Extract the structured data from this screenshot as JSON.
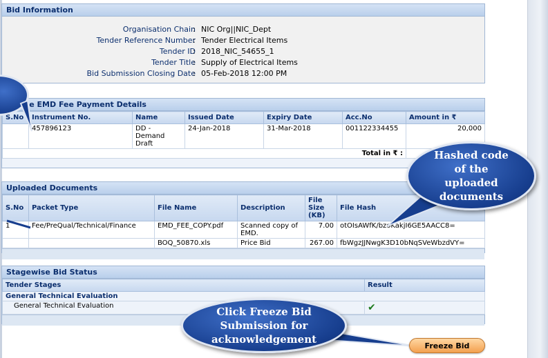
{
  "bid_info": {
    "title": "Bid Information",
    "rows": [
      {
        "label": "Organisation Chain",
        "value": "NIC Org||NIC_Dept"
      },
      {
        "label": "Tender Reference Number",
        "value": "Tender Electrical Items"
      },
      {
        "label": "Tender ID",
        "value": "2018_NIC_54655_1"
      },
      {
        "label": "Tender Title",
        "value": "Supply of Electrical Items"
      },
      {
        "label": "Bid Submission Closing Date",
        "value": "05-Feb-2018 12:00 PM"
      }
    ]
  },
  "emd": {
    "title": "Offline EMD Fee Payment Details",
    "columns": [
      "S.No",
      "Instrument No.",
      "Name",
      "Issued Date",
      "Expiry Date",
      "Acc.No",
      "Amount in ₹"
    ],
    "rows": [
      {
        "sno": "",
        "instrument": "457896123",
        "name": "DD - Demand Draft",
        "issued": "24-Jan-2018",
        "expiry": "31-Mar-2018",
        "acc": "001122334455",
        "amount": "20,000"
      }
    ],
    "total_label": "Total in ₹ :"
  },
  "uploads": {
    "title": "Uploaded Documents",
    "columns": [
      "S.No",
      "Packet Type",
      "File Name",
      "Description",
      "File Size (KB)",
      "File Hash"
    ],
    "rows": [
      {
        "sno": "1",
        "packet": "Fee/PreQual/Technical/Finance",
        "file": "EMD_FEE_COPY.pdf",
        "desc": "Scanned copy of EMD.",
        "size": "7.00",
        "hash": "otOIsAWfK/bzoKakjI6GE5AACC8="
      },
      {
        "sno": "",
        "packet": "",
        "file": "BOQ_50870.xls",
        "desc": "Price Bid",
        "size": "267.00",
        "hash": "fbWgzJJNwgK3D10bNqSVeWbzdVY="
      }
    ]
  },
  "stages": {
    "title": "Stagewise Bid Status",
    "columns": [
      "Tender Stages",
      "Result"
    ],
    "group": "General Technical Evaluation",
    "items": [
      {
        "stage": "General Technical Evaluation",
        "result": "✔"
      }
    ]
  },
  "callouts": {
    "hash": [
      "Hashed code",
      "of the",
      "uploaded",
      "documents"
    ],
    "freeze": [
      "Click Freeze Bid",
      "Submission for",
      "acknowledgement"
    ]
  },
  "freeze_button": "Freeze Bid",
  "colors": {
    "header_text": "#0c2f6e",
    "callout": "#173e8e",
    "button": "#f3a04f",
    "check": "#1d7a1d"
  }
}
